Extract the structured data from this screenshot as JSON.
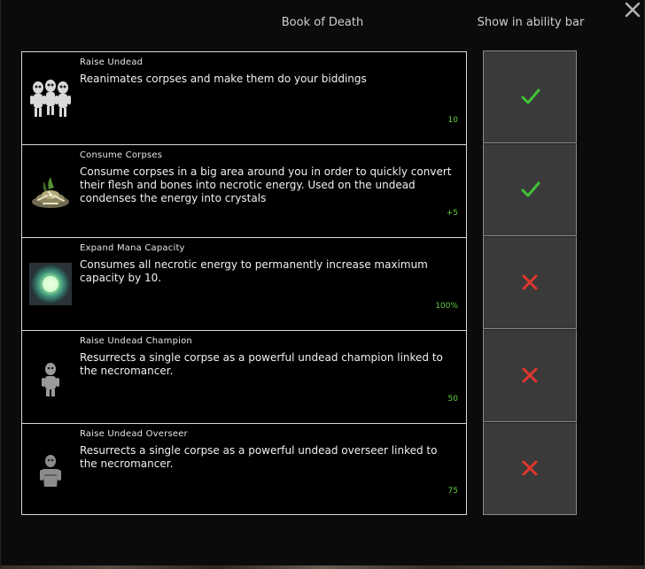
{
  "header": {
    "title": "Book of Death",
    "toggle_column": "Show in ability bar"
  },
  "icons": {
    "close": "close-icon",
    "enabled": "checkmark-icon",
    "disabled": "cross-icon"
  },
  "colors": {
    "accent_green": "#5fcf3a",
    "check_green": "#3fc236",
    "cross_red": "#e0362e",
    "toggle_bg": "#3a3a3a"
  },
  "abilities": [
    {
      "name": "Raise Undead",
      "description": "Reanimates corpses and make them do your biddings",
      "cost": "10",
      "icon": "skeleton-group-icon",
      "show_in_bar": true
    },
    {
      "name": "Consume Corpses",
      "description": "Consume corpses in a big area around you in order to quickly convert their flesh and bones into necrotic energy. Used on the undead condenses the energy into crystals",
      "cost": "+5",
      "icon": "bone-pile-icon",
      "show_in_bar": true
    },
    {
      "name": "Expand Mana Capacity",
      "description": "Consumes all necrotic energy to permanently increase maximum capacity by 10.",
      "cost": "100%",
      "icon": "mana-orb-icon",
      "show_in_bar": false
    },
    {
      "name": "Raise Undead Champion",
      "description": "Resurrects a single corpse as a powerful undead champion linked to the necromancer.",
      "cost": "50",
      "icon": "undead-champion-icon",
      "show_in_bar": false
    },
    {
      "name": "Raise Undead Overseer",
      "description": "Resurrects a single corpse as a powerful undead overseer linked to the necromancer.",
      "cost": "75",
      "icon": "undead-overseer-icon",
      "show_in_bar": false
    }
  ]
}
